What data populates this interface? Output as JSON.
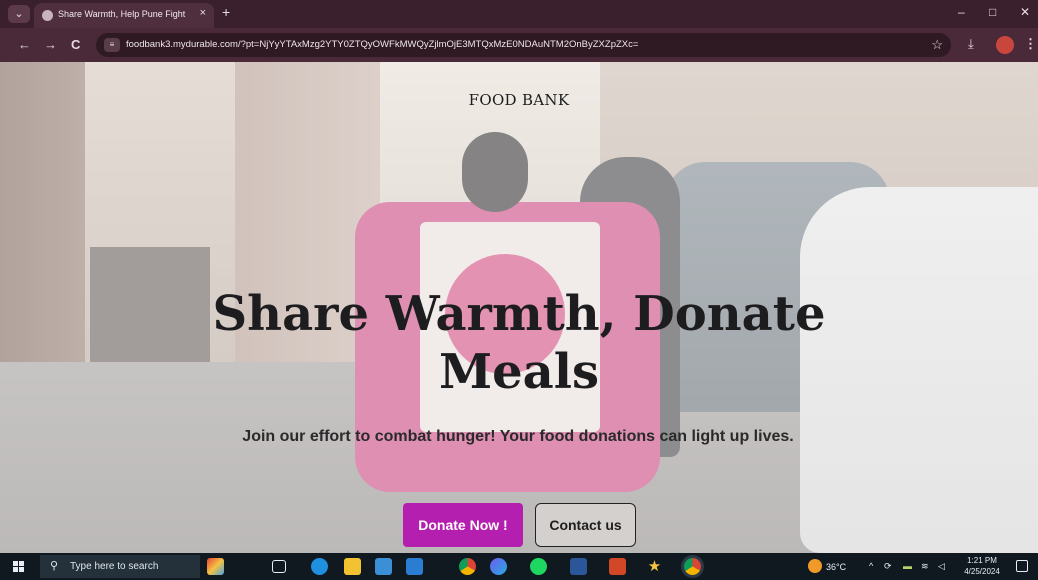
{
  "browser": {
    "tab_title": "Share Warmth, Help Pune Fight",
    "tab_close": "×",
    "new_tab": "+",
    "tab_menu_icon": "chevron-down-icon",
    "url": "foodbank3.mydurable.com/?pt=NjYyYTAxMzg2YTY0ZTQyOWFkMWQyZjlmOjE3MTQxMzE0NDAuNTM2OnByZXZpZXc=",
    "window_controls": {
      "minimize": "–",
      "maximize": "□",
      "close": "✕"
    },
    "nav": {
      "back": "←",
      "forward": "→",
      "reload": "C"
    },
    "icons": [
      "bookmark-star-icon",
      "download-icon",
      "profile-avatar-icon",
      "more-menu-icon"
    ]
  },
  "page": {
    "brand": "FOOD BANK",
    "hero_title": "Share Warmth, Donate Meals",
    "hero_subtitle": "Join our effort to combat hunger! Your food donations can light up lives.",
    "primary_button": "Donate Now !",
    "secondary_button": "Contact us",
    "colors": {
      "primary_button_bg": "#b51fb0",
      "text": "#1d1d1f"
    }
  },
  "taskbar": {
    "search_placeholder": "Type here to search",
    "weather": "36°C",
    "time": "1:21 PM",
    "date": "4/25/2024",
    "apps": [
      "widget-icon",
      "task-view-icon",
      "edge-icon",
      "file-explorer-icon",
      "store-icon",
      "mail-icon",
      "chrome-icon",
      "copilot-icon",
      "spotify-icon",
      "word-icon",
      "powerpoint-icon",
      "star-app-icon",
      "chrome-active-icon"
    ]
  }
}
